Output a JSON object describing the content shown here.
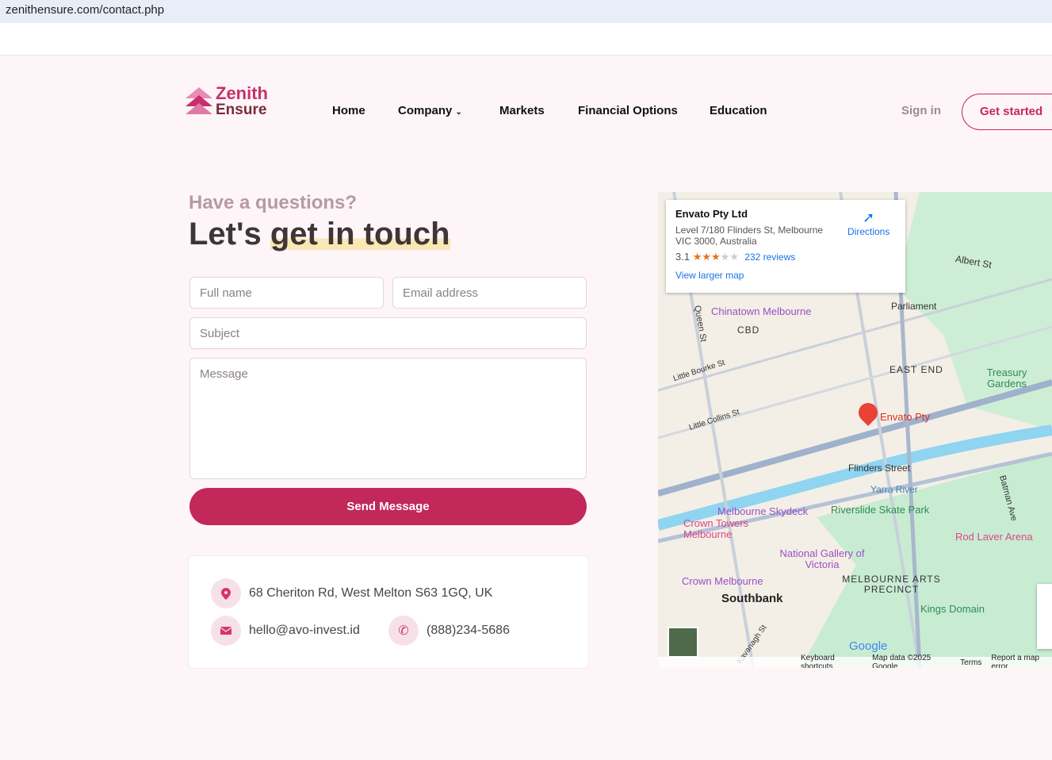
{
  "browser": {
    "url": "zenithensure.com/contact.php"
  },
  "brand": {
    "line1": "Zenith",
    "line2": "Ensure",
    "color": "#c7306a"
  },
  "nav": {
    "items": [
      "Home",
      "Company",
      "Markets",
      "Financial Options",
      "Education"
    ],
    "signin": "Sign in",
    "get_started": "Get started"
  },
  "hero": {
    "eyebrow": "Have a questions?",
    "title_plain": "Let's ",
    "title_highlight": "get in touch"
  },
  "form": {
    "full_name_placeholder": "Full name",
    "email_placeholder": "Email address",
    "subject_placeholder": "Subject",
    "message_placeholder": "Message",
    "submit": "Send Message",
    "accent": "#c2285a"
  },
  "contact": {
    "address": "68 Cheriton Rd, West Melton S63 1GQ, UK",
    "email": "hello@avo-invest.id",
    "phone": "(888)234-5686"
  },
  "map": {
    "place_name": "Envato Pty Ltd",
    "address": "Level 7/180 Flinders St, Melbourne VIC 3000, Australia",
    "rating": "3.1",
    "rating_value": 3.1,
    "reviews": "232 reviews",
    "directions": "Directions",
    "larger_map": "View larger map",
    "labels": [
      "Chinatown Melbourne",
      "CBD",
      "Parliament",
      "EAST END",
      "Treasury Gardens",
      "Little Bourke St",
      "Little Collins St",
      "Envato Pty",
      "Flinders Street",
      "Yarra River",
      "Melbourne Skydeck",
      "Riverslide Skate Park",
      "Crown Towers Melbourne",
      "National Gallery of Victoria",
      "Rod Laver Arena",
      "Crown Melbourne",
      "Southbank",
      "MELBOURNE ARTS PRECINCT",
      "Kings Domain",
      "Albert St",
      "Queen St",
      "Kavanagh St",
      "Batman Ave"
    ],
    "footer": [
      "Keyboard shortcuts",
      "Map data ©2025 Google",
      "Terms",
      "Report a map error"
    ],
    "google": "Google"
  }
}
